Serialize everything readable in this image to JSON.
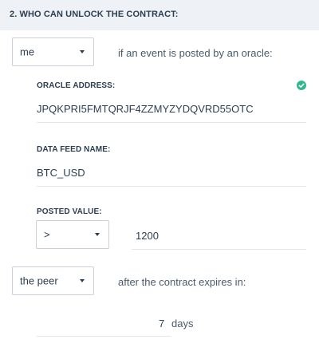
{
  "section": {
    "title": "2. WHO CAN UNLOCK THE CONTRACT:"
  },
  "oracle_rule": {
    "selector_value": "me",
    "description": "if an event is posted by an oracle:",
    "oracle_address": {
      "label": "ORACLE ADDRESS:",
      "value": "JPQKPRI5FMTQRJF4ZZMYZYDQVRD55OTC",
      "status_icon": "check-circle-icon",
      "status_color": "#2fb88e"
    },
    "data_feed": {
      "label": "DATA FEED NAME:",
      "value": "BTC_USD"
    },
    "posted_value": {
      "label": "POSTED VALUE:",
      "operator": ">",
      "value": "1200"
    }
  },
  "expiry_rule": {
    "selector_value": "the peer",
    "description": "after the contract expires in:",
    "days_value": "7",
    "days_unit": "days"
  }
}
